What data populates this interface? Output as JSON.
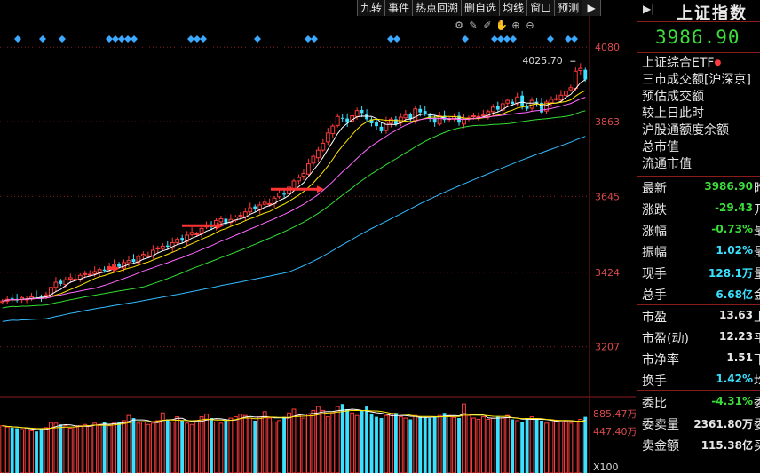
{
  "toolbar": {
    "buttons": [
      "九转",
      "事件",
      "热点回溯",
      "删自选",
      "均线",
      "窗口",
      "预测"
    ],
    "play_icon": "play-icon"
  },
  "tool_icons": [
    "settings-icon",
    "pen-icon",
    "draw-icon",
    "hand-icon",
    "zoom-in-icon",
    "zoom-out-icon"
  ],
  "chart_data": {
    "type": "candlestick",
    "price_axis": {
      "ticks": [
        "4080",
        "3863",
        "3645",
        "3424",
        "3207"
      ],
      "ylim": [
        3100,
        4140
      ]
    },
    "high_label": "4025.70",
    "volume_axis": {
      "ticks": [
        "885.47万",
        "447.40万"
      ],
      "unit": "X100",
      "ylim": [
        0,
        1000
      ]
    },
    "colors": {
      "up": "#ff3b3b",
      "down": "#3ce0ff",
      "ma5": "#ffffff",
      "ma10": "#ffe600",
      "ma20": "#ff66ff",
      "ma30": "#33dd33",
      "ma60": "#33bbff",
      "arrow": "#ff3333",
      "grid": "#8c1c1c"
    },
    "closes": [
      3340,
      3345,
      3348,
      3342,
      3350,
      3346,
      3352,
      3355,
      3350,
      3358,
      3380,
      3395,
      3390,
      3402,
      3408,
      3404,
      3415,
      3420,
      3418,
      3426,
      3432,
      3428,
      3440,
      3446,
      3440,
      3452,
      3458,
      3454,
      3470,
      3476,
      3472,
      3488,
      3495,
      3500,
      3498,
      3510,
      3520,
      3516,
      3532,
      3540,
      3536,
      3552,
      3560,
      3556,
      3575,
      3580,
      3565,
      3578,
      3585,
      3590,
      3600,
      3612,
      3608,
      3620,
      3628,
      3624,
      3640,
      3655,
      3650,
      3672,
      3690,
      3700,
      3712,
      3740,
      3762,
      3780,
      3800,
      3830,
      3850,
      3878,
      3872,
      3860,
      3880,
      3895,
      3888,
      3870,
      3858,
      3850,
      3835,
      3862,
      3870,
      3855,
      3876,
      3882,
      3870,
      3900,
      3890,
      3885,
      3872,
      3860,
      3880,
      3868,
      3872,
      3878,
      3860,
      3870,
      3874,
      3880,
      3878,
      3882,
      3892,
      3905,
      3898,
      3915,
      3925,
      3915,
      3935,
      3910,
      3900,
      3925,
      3918,
      3890,
      3920,
      3928,
      3930,
      3940,
      3952,
      3962,
      4010,
      4018,
      3986
    ],
    "volumes": [
      560,
      540,
      530,
      520,
      500,
      520,
      480,
      470,
      520,
      530,
      610,
      600,
      580,
      560,
      520,
      540,
      560,
      580,
      560,
      600,
      580,
      620,
      560,
      600,
      620,
      640,
      720,
      680,
      600,
      620,
      580,
      600,
      640,
      760,
      660,
      620,
      700,
      640,
      600,
      580,
      620,
      700,
      740,
      680,
      620,
      600,
      640,
      680,
      700,
      740,
      720,
      680,
      640,
      700,
      780,
      680,
      620,
      640,
      700,
      760,
      820,
      720,
      680,
      740,
      800,
      860,
      800,
      700,
      760,
      860,
      900,
      820,
      760,
      720,
      800,
      860,
      740,
      700,
      680,
      720,
      740,
      760,
      700,
      680,
      660,
      720,
      700,
      690,
      680,
      700,
      720,
      760,
      720,
      690,
      680,
      900,
      720,
      680,
      660,
      700,
      660,
      680,
      700,
      680,
      720,
      660,
      640,
      620,
      680,
      700,
      660,
      640,
      600,
      620,
      640,
      620,
      640,
      600,
      620,
      660,
      700
    ],
    "arrows": [
      {
        "from": 120,
        "to": 135,
        "y": 3435
      },
      {
        "from": 205,
        "to": 252,
        "y": 3560
      },
      {
        "from": 305,
        "to": 365,
        "y": 3666
      }
    ],
    "diamond_marks": [
      20,
      48,
      70,
      123,
      130,
      137,
      144,
      151,
      215,
      222,
      229,
      290,
      347,
      354,
      440,
      447,
      524,
      557,
      564,
      571,
      578,
      620,
      640,
      647
    ]
  },
  "panel": {
    "title": "上证指数",
    "price": "3986.90",
    "info_rows": [
      "上证综合ETF",
      "三市成交额[沪深京]",
      "预估成交额",
      "较上日此时",
      "沪股通额度余额",
      "总市值",
      "流通市值"
    ],
    "quotes": [
      {
        "label": "最新",
        "value": "3986.90",
        "ext": "昨",
        "color": "green"
      },
      {
        "label": "涨跌",
        "value": "-29.43",
        "ext": "开",
        "color": "green"
      },
      {
        "label": "涨幅",
        "value": "-0.73%",
        "ext": "最",
        "color": "green"
      },
      {
        "label": "振幅",
        "value": "1.02%",
        "ext": "最",
        "color": "cyan"
      },
      {
        "label": "现手",
        "value": "128.1万",
        "ext": "量",
        "color": "cyan"
      },
      {
        "label": "总手",
        "value": "6.68亿",
        "ext": "金",
        "color": "cyan"
      },
      {
        "label": "市盈",
        "value": "13.63",
        "ext": "上",
        "color": "white"
      },
      {
        "label": "市盈(动)",
        "value": "12.23",
        "ext": "平",
        "color": "white"
      },
      {
        "label": "市净率",
        "value": "1.51",
        "ext": "下",
        "color": "white"
      },
      {
        "label": "换手",
        "value": "1.42%",
        "ext": "均",
        "color": "cyan"
      },
      {
        "label": "委比",
        "value": "-4.31%",
        "ext": "委",
        "color": "green"
      },
      {
        "label": "委卖量",
        "value": "2361.80万",
        "ext": "委",
        "color": "white"
      },
      {
        "label": "卖金额",
        "value": "115.38亿",
        "ext": "买",
        "color": "white"
      }
    ]
  }
}
